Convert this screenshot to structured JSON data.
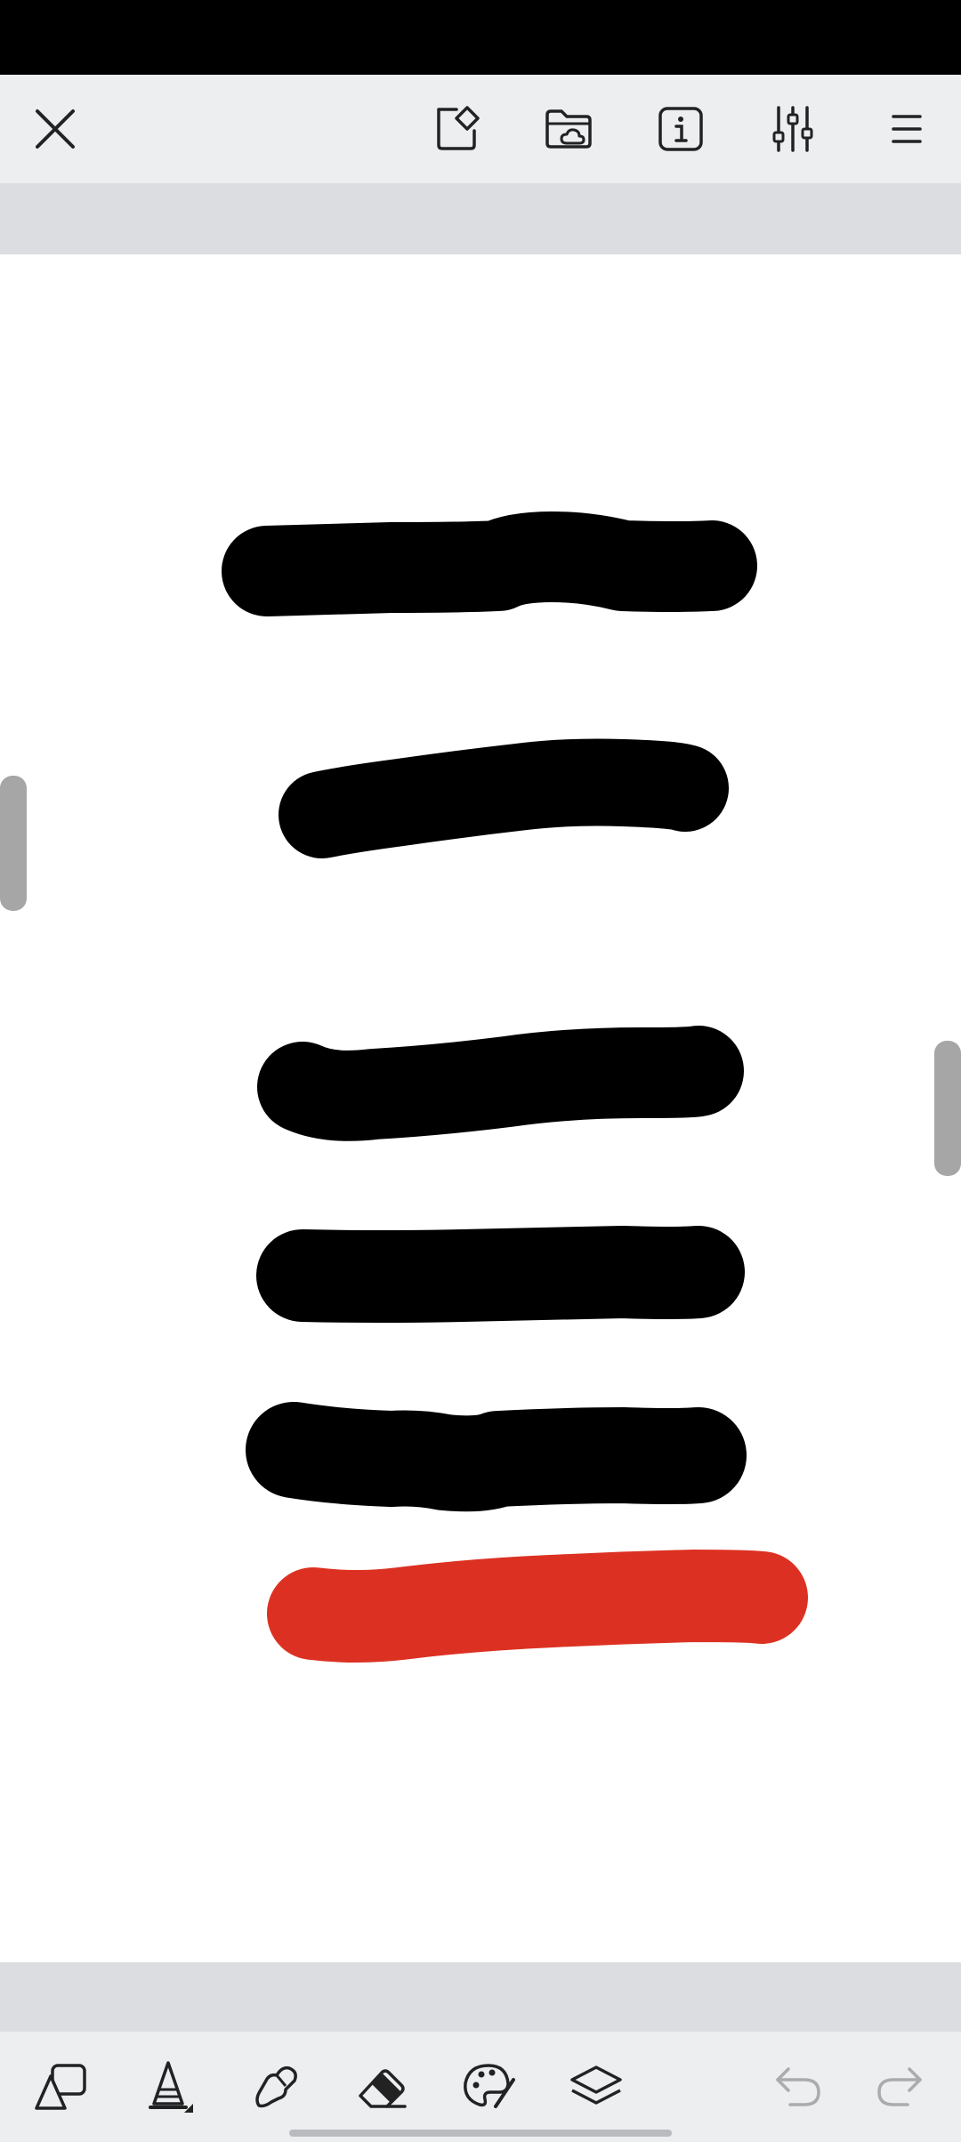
{
  "status_bar": {
    "color": "#000000"
  },
  "top_toolbar": {
    "icons": [
      "close-icon",
      "edit-page-icon",
      "cloud-folder-icon",
      "info-icon",
      "sliders-icon",
      "menu-icon"
    ]
  },
  "canvas": {
    "background": "#ffffff",
    "strokes": [
      {
        "color": "#000000"
      },
      {
        "color": "#000000"
      },
      {
        "color": "#000000"
      },
      {
        "color": "#000000"
      },
      {
        "color": "#000000"
      },
      {
        "color": "#dc3122"
      }
    ]
  },
  "bottom_toolbar": {
    "icons": [
      "shapes-icon",
      "pen-tool-icon",
      "smudge-icon",
      "eraser-icon",
      "palette-icon",
      "layers-icon",
      "undo-icon",
      "redo-icon"
    ],
    "undo_enabled": false,
    "redo_enabled": false
  }
}
